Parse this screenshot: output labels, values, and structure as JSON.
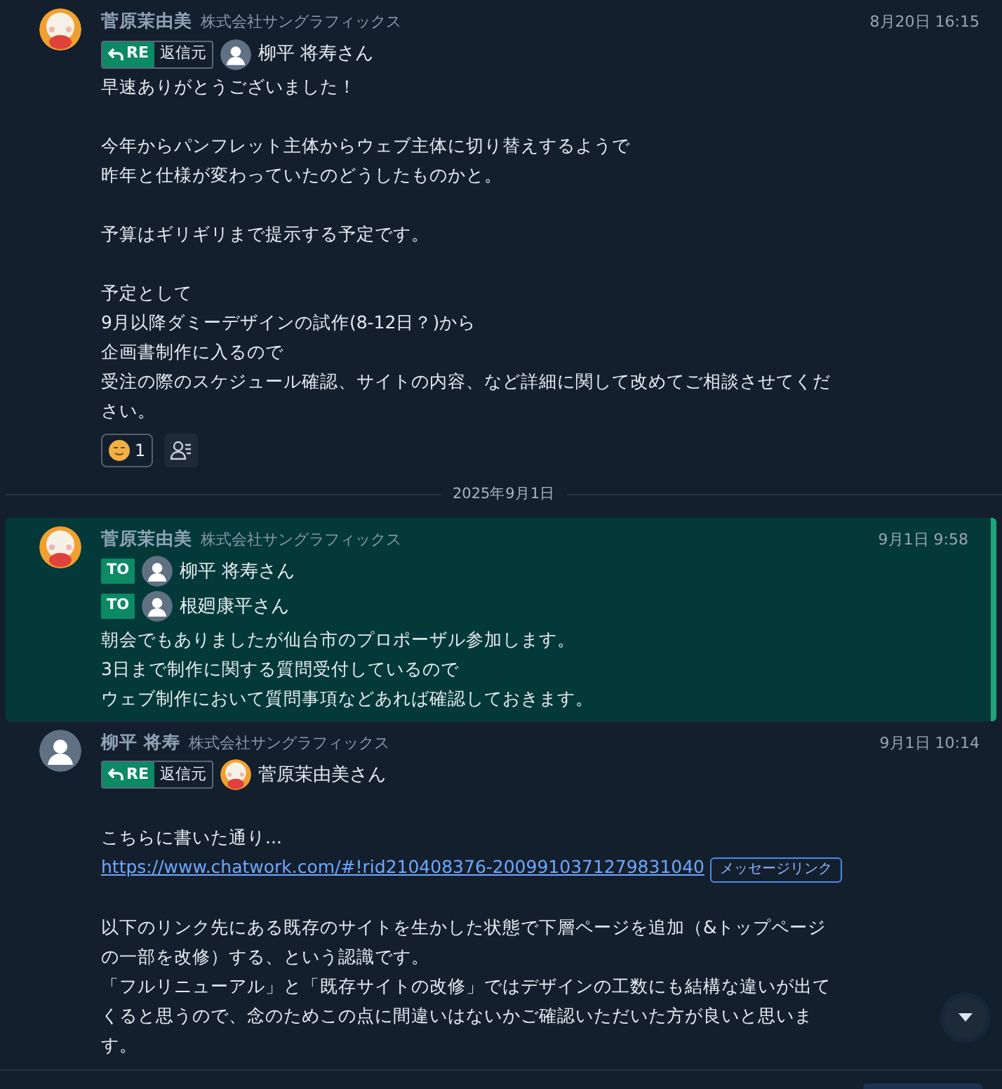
{
  "timeline": [
    {
      "kind": "message",
      "highlighted": false,
      "avatar": {
        "kind": "character"
      },
      "sender": "菅原茉由美",
      "company": "株式会社サングラフィックス",
      "time": "8月20日 16:15",
      "refs": [
        {
          "kind": "re",
          "tag": "RE",
          "sub": "返信元",
          "avatar": {
            "kind": "person"
          },
          "name": "柳平 将寿さん"
        }
      ],
      "body": [
        {
          "kind": "text",
          "lines": [
            "早速ありがとうございました！"
          ]
        },
        {
          "kind": "text",
          "lines": [
            "今年からパンフレット主体からウェブ主体に切り替えするようで",
            "昨年と仕様が変わっていたのどうしたものかと。"
          ]
        },
        {
          "kind": "text",
          "lines": [
            "予算はギリギリまで提示する予定です。"
          ]
        },
        {
          "kind": "text",
          "lines": [
            "予定として",
            "9月以降ダミーデザインの試作(8-12日？)から",
            "企画書制作に入るので",
            "受注の際のスケジュール確認、サイトの内容、など詳細に関して改めてご相談させてくだ",
            "さい。"
          ]
        }
      ],
      "reactions": [
        {
          "count": "1"
        }
      ],
      "read_button": true
    },
    {
      "kind": "date",
      "label": "2025年9月1日"
    },
    {
      "kind": "message",
      "highlighted": true,
      "avatar": {
        "kind": "character"
      },
      "sender": "菅原茉由美",
      "company": "株式会社サングラフィックス",
      "time": "9月1日 9:58",
      "refs": [
        {
          "kind": "to",
          "tag": "TO",
          "avatar": {
            "kind": "person"
          },
          "name": "柳平 将寿さん"
        },
        {
          "kind": "to",
          "tag": "TO",
          "avatar": {
            "kind": "person"
          },
          "name": "根廻康平さん"
        }
      ],
      "body": [
        {
          "kind": "text",
          "lines": [
            "朝会でもありましたが仙台市のプロポーザル参加します。",
            "3日まで制作に関する質問受付しているので",
            "ウェブ制作において質問事項などあれば確認しておきます。"
          ]
        }
      ]
    },
    {
      "kind": "message",
      "highlighted": false,
      "avatar": {
        "kind": "person"
      },
      "sender": "柳平 将寿",
      "company": "株式会社サングラフィックス",
      "time": "9月1日 10:14",
      "refs": [
        {
          "kind": "re",
          "tag": "RE",
          "sub": "返信元",
          "avatar": {
            "kind": "character"
          },
          "name": "菅原茉由美さん"
        }
      ],
      "gap_before_body": true,
      "body": [
        {
          "kind": "text",
          "lines": [
            "こちらに書いた通り..."
          ]
        },
        {
          "kind": "link",
          "url": "https://www.chatwork.com/#!rid210408376-2009910371279831040",
          "button": "メッセージリンク"
        },
        {
          "kind": "text",
          "lines": [
            "以下のリンク先にある既存のサイトを生かした状態で下層ページを追加（&トップページ",
            "の一部を改修）する、という認識です。",
            "「フルリニューアル」と「既存サイトの改修」ではデザインの工数にも結構な違いが出て",
            "くると思うので、念のためこの点に間違いはないかご確認いただいた方が良いと思いま",
            "す。"
          ]
        }
      ]
    }
  ]
}
